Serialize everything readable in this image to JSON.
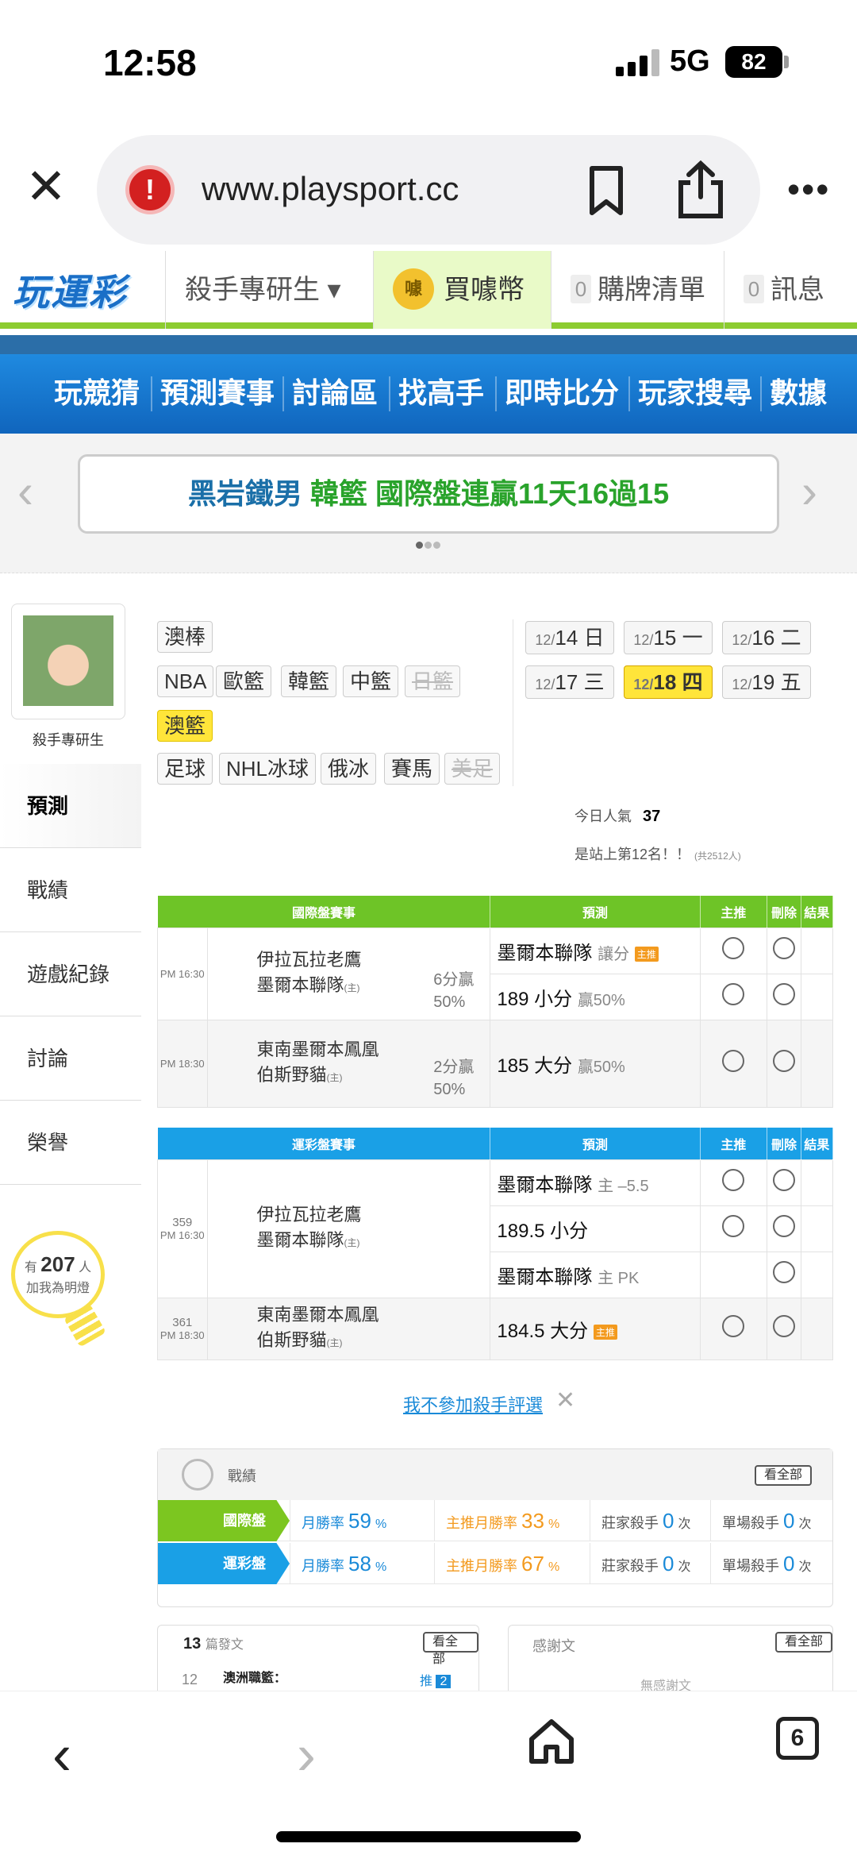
{
  "status": {
    "time": "12:58",
    "network": "5G",
    "battery": "82"
  },
  "browser": {
    "url": "www.playsport.cc",
    "tabs": "6"
  },
  "site": {
    "logo": "玩運彩",
    "member": "殺手專研生 ▾",
    "coin": "買噱幣",
    "coin_icon": "噱",
    "cart_count": "0",
    "cart": "購牌清單",
    "msg_count": "0",
    "msg": "訊息"
  },
  "nav": [
    "玩競猜",
    "預測賽事",
    "討論區",
    "找高手",
    "即時比分",
    "玩家搜尋",
    "數據"
  ],
  "banner": {
    "part1": "黑岩鐵男",
    "part2": "韓籃",
    "part3": "國際盤連贏11天16過15"
  },
  "sidebar": {
    "user_name": "殺手專研生",
    "menu": [
      "預測",
      "戰績",
      "遊戲紀錄",
      "討論",
      "榮譽"
    ],
    "fans_prefix": "有",
    "fans_count": "207",
    "fans_unit": "人",
    "fans_text": "加我為明燈"
  },
  "sports": {
    "tags": [
      "澳棒",
      "NBA",
      "歐籃",
      "韓籃",
      "中籃",
      "日籃",
      "澳籃",
      "足球",
      "NHL冰球",
      "俄冰",
      "賽馬",
      "美足"
    ],
    "active": "澳籃"
  },
  "dates": [
    {
      "md": "12/",
      "d": "14",
      "w": "日"
    },
    {
      "md": "12/",
      "d": "15",
      "w": "一"
    },
    {
      "md": "12/",
      "d": "16",
      "w": "二"
    },
    {
      "md": "12/",
      "d": "17",
      "w": "三"
    },
    {
      "md": "12/",
      "d": "18",
      "w": "四"
    },
    {
      "md": "12/",
      "d": "19",
      "w": "五"
    }
  ],
  "popularity": {
    "label": "今日人氣",
    "value": "37",
    "rank_text": "是站上第12名！！",
    "total_text": "(共2512人)"
  },
  "intl_table": {
    "headers": [
      "國際盤賽事",
      "預測",
      "主推",
      "刪除",
      "結果"
    ],
    "game1": {
      "time": "PM 16:30",
      "away": "伊拉瓦拉老鷹",
      "home": "墨爾本聯隊",
      "home_mark": "(主)",
      "stat1": "6分贏",
      "stat2": "50%",
      "pred1": "墨爾本聯隊",
      "pred1_sub": "讓分",
      "pred1_tag": "主推",
      "pred2": "189 小分",
      "pred2_sub": "贏50%"
    },
    "game2": {
      "time": "PM 18:30",
      "away": "東南墨爾本鳳凰",
      "home": "伯斯野貓",
      "home_mark": "(主)",
      "stat1": "2分贏",
      "stat2": "50%",
      "pred1": "185 大分",
      "pred1_sub": "贏50%"
    }
  },
  "lottery_table": {
    "headers": [
      "運彩盤賽事",
      "預測",
      "主推",
      "刪除",
      "結果"
    ],
    "game1": {
      "no": "359",
      "time": "PM 16:30",
      "away": "伊拉瓦拉老鷹",
      "home": "墨爾本聯隊",
      "home_mark": "(主)",
      "pred1": "墨爾本聯隊",
      "pred1_sub": "主 –5.5",
      "pred2": "189.5 小分",
      "pred3": "墨爾本聯隊",
      "pred3_sub": "主 PK"
    },
    "game2": {
      "no": "361",
      "time": "PM 18:30",
      "away": "東南墨爾本鳳凰",
      "home": "伯斯野貓",
      "home_mark": "(主)",
      "pred1": "184.5 大分",
      "pred1_tag": "主推"
    }
  },
  "optout": "我不參加殺手評選",
  "record": {
    "title": "戰績",
    "see_all": "看全部",
    "rows": [
      {
        "label": "國際盤",
        "color": "#7cc620",
        "month_label": "月勝率",
        "month": "59",
        "main_label": "主推月勝率",
        "main": "33",
        "banker_label": "莊家殺手",
        "banker": "0",
        "banker_unit": "次",
        "single_label": "單場殺手",
        "single": "0",
        "single_unit": "次"
      },
      {
        "label": "運彩盤",
        "color": "#1aa0e6",
        "month_label": "月勝率",
        "month": "58",
        "main_label": "主推月勝率",
        "main": "67",
        "banker_label": "莊家殺手",
        "banker": "0",
        "banker_unit": "次",
        "single_label": "單場殺手",
        "single": "0",
        "single_unit": "次"
      }
    ],
    "percent": "%"
  },
  "posts": {
    "count": "13",
    "label": "篇發文",
    "see_all": "看全部",
    "item_no": "12",
    "item_title": "澳洲職籃：",
    "push": "推",
    "push_count": "2"
  },
  "thanks": {
    "label": "感謝文",
    "see_all": "看全部",
    "empty": "無感謝文"
  }
}
